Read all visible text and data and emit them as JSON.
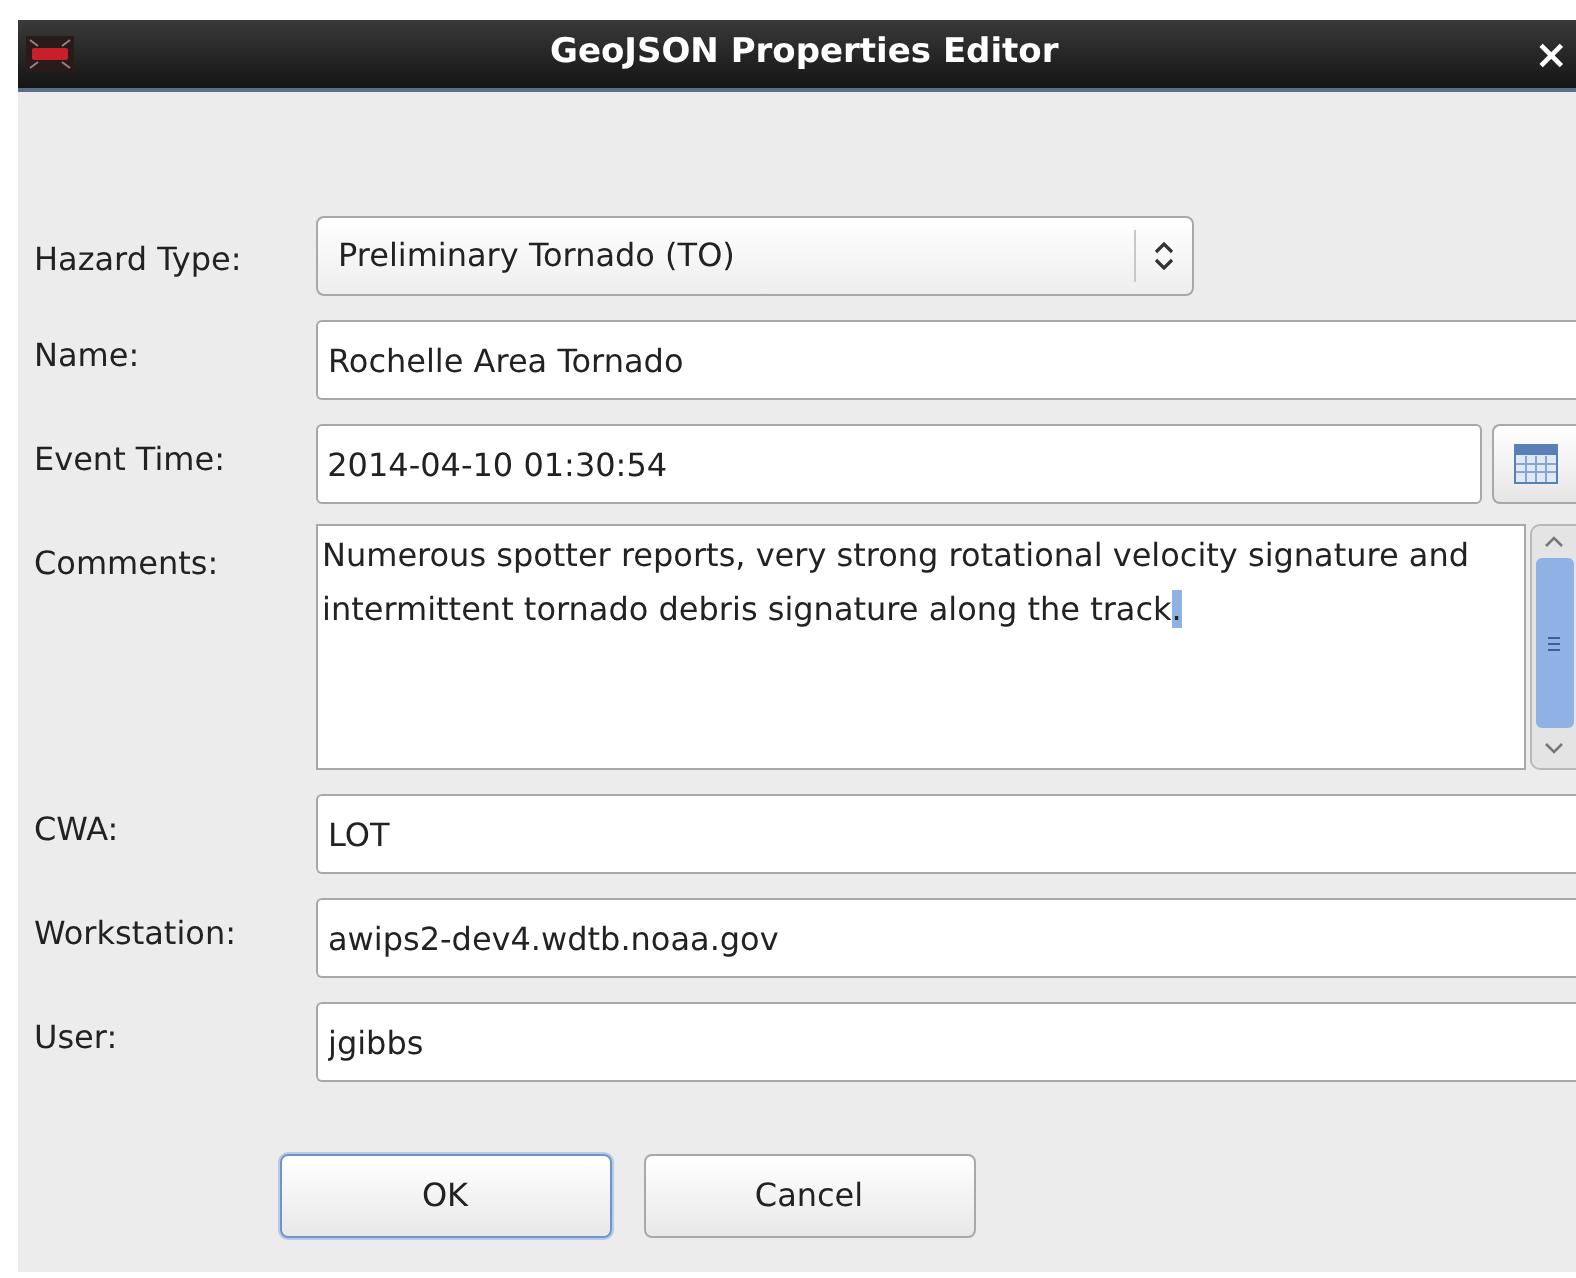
{
  "window": {
    "title": "GeoJSON Properties Editor",
    "close": "×"
  },
  "fields": [
    {
      "kind": "combo",
      "label": "Hazard Type:",
      "value": "Preliminary Tornado (TO)"
    },
    {
      "kind": "text",
      "label": "Name:",
      "value": "Rochelle Area Tornado"
    },
    {
      "kind": "date",
      "label": "Event Time:",
      "value": "2014-04-10 01:30:54"
    },
    {
      "kind": "area",
      "label": "Comments:",
      "value": "Numerous spotter reports, very strong rotational velocity signature and intermittent tornado debris signature along the track",
      "selection": "."
    },
    {
      "kind": "text",
      "label": "CWA:",
      "value": "LOT"
    },
    {
      "kind": "text",
      "label": "Workstation:",
      "value": "awips2-dev4.wdtb.noaa.gov"
    },
    {
      "kind": "text",
      "label": "User:",
      "value": "jgibbs"
    }
  ],
  "buttons": [
    {
      "label": "OK",
      "focused": true
    },
    {
      "label": "Cancel",
      "focused": false
    }
  ]
}
